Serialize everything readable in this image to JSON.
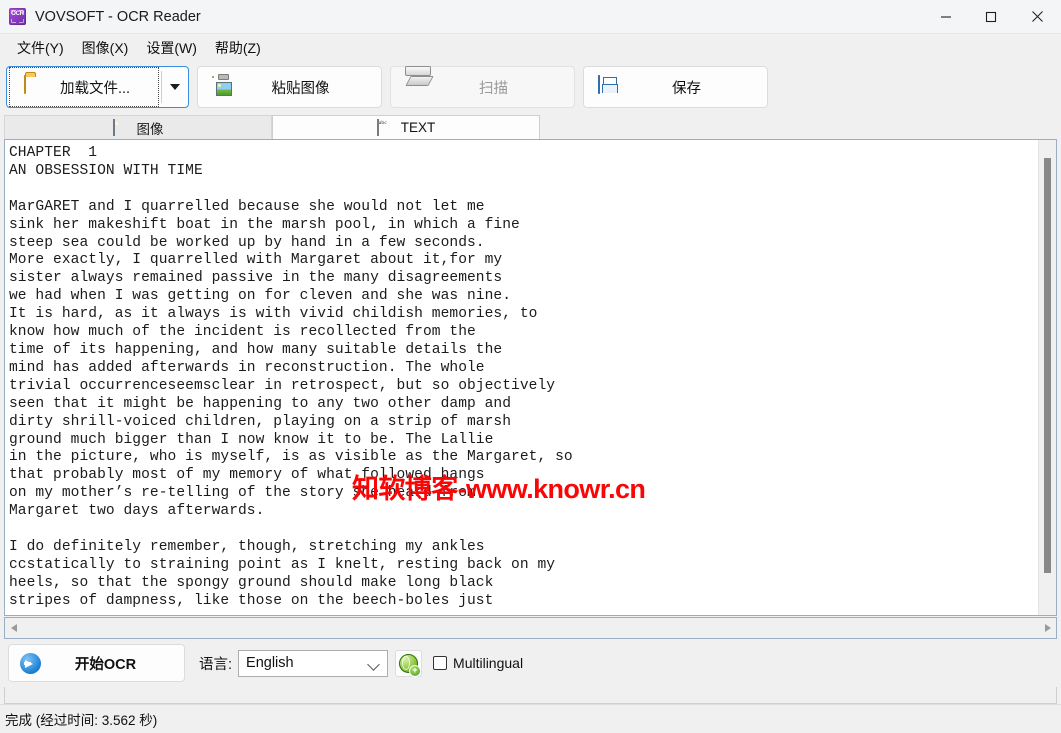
{
  "window": {
    "title": "VOVSOFT - OCR Reader",
    "app_icon": "ocr-app-icon",
    "controls": {
      "minimize": "minimize-icon",
      "maximize": "maximize-icon",
      "close": "close-icon"
    }
  },
  "menubar": {
    "items": [
      {
        "label": "文件(Y)"
      },
      {
        "label": "图像(X)"
      },
      {
        "label": "设置(W)"
      },
      {
        "label": "帮助(Z)"
      }
    ]
  },
  "toolbar": {
    "load_file": {
      "label": "加载文件...",
      "icon": "folder-icon",
      "dropdown": "chevron-down-icon",
      "focused": true
    },
    "paste_image": {
      "label": "粘贴图像",
      "icon": "clipboard-image-icon"
    },
    "scan": {
      "label": "扫描",
      "icon": "scanner-icon",
      "disabled": true
    },
    "save": {
      "label": "保存",
      "icon": "floppy-disk-icon"
    }
  },
  "tabs": [
    {
      "label": "图像",
      "icon": "image-icon",
      "active": false
    },
    {
      "label": "TEXT",
      "icon": "text-document-icon",
      "active": true
    }
  ],
  "editor": {
    "watermark": "知软博客-www.knowr.cn",
    "watermark_color": "#fb0606",
    "content": "CHAPTER  1\nAN OBSESSION WITH TIME\n\nMarGARET and I quarrelled because she would not let me\nsink her makeshift boat in the marsh pool, in which a fine\nsteep sea could be worked up by hand in a few seconds.\nMore exactly, I quarrelled with Margaret about it,for my\nsister always remained passive in the many disagreements\nwe had when I was getting on for cleven and she was nine.\nIt is hard, as it always is with vivid childish memories, to\nknow how much of the incident is recollected from the\ntime of its happening, and how many suitable details the\nmind has added afterwards in reconstruction. The whole\ntrivial occurrenceseemsclear in retrospect, but so objectively\nseen that it might be happening to any two other damp and\ndirty shrill-voiced children, playing on a strip of marsh\nground much bigger than I now know it to be. The Lallie\nin the picture, who is myself, is as visible as the Margaret, so\nthat probably most of my memory of what followed hangs\non my mother’s re-telling of the story she heard from\nMargaret two days afterwards.\n\nI do definitely remember, though, stretching my ankles\nccstatically to straining point as I knelt, resting back on my\nheels, so that the spongy ground should make long black\nstripes of dampness, like those on the beech-boles just"
  },
  "scrollbars": {
    "vertical": "vertical-scrollbar",
    "horizontal_left_arrow": "scroll-left-arrow-icon",
    "horizontal_right_arrow": "scroll-right-arrow-icon"
  },
  "bottom": {
    "start_ocr": {
      "label": "开始OCR",
      "icon": "blue-arrow-icon"
    },
    "language_label": "语言:",
    "language_value": "English",
    "language_options": [
      "English"
    ],
    "add_language": {
      "icon": "globe-add-icon"
    },
    "multilingual": {
      "label": "Multilingual",
      "checked": false
    }
  },
  "status": {
    "text": "完成  (经过时间: 3.562 秒)"
  }
}
